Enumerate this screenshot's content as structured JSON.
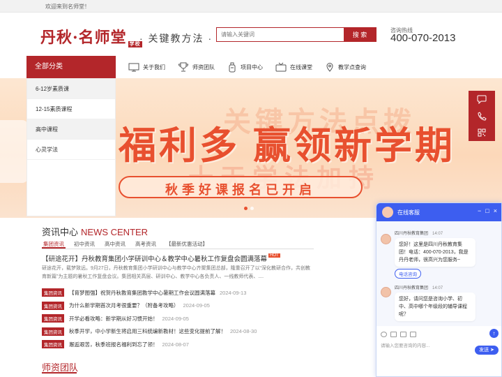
{
  "topbar": {
    "welcome": "欢迎来到名师堂！"
  },
  "header": {
    "logo_text": "丹秋·名师堂",
    "logo_tag": "学校",
    "slogan": "· 关键教方法 ·",
    "search_placeholder": "请输入关键词",
    "search_button": "搜 索",
    "hotline_label": "咨询热线",
    "hotline": "400-070-2013"
  },
  "category": {
    "title": "全部分类",
    "items": [
      "6-12岁素质课",
      "12-15素质课程",
      "高中课程",
      "心灵学法"
    ]
  },
  "nav": {
    "items": [
      {
        "label": "关于我们",
        "icon": "monitor-icon"
      },
      {
        "label": "师资团队",
        "icon": "trophy-icon"
      },
      {
        "label": "项目中心",
        "icon": "bottle-icon"
      },
      {
        "label": "在线课堂",
        "icon": "tv-icon"
      },
      {
        "label": "教学点查询",
        "icon": "pin-icon"
      }
    ]
  },
  "banner": {
    "ghost_line1": "关键方法点拨",
    "headline": "福利多 赢领新学期",
    "ghost_line2": "十天学法加持",
    "pill_text": "秋季好课报名已开启"
  },
  "news": {
    "title": "资讯中心",
    "title_en": "NEWS CENTER",
    "tabs": [
      "集团资讯",
      "初中资讯",
      "高中资讯",
      "高考资讯",
      "【最新优惠活动】"
    ],
    "feature_title": "【研途花开】丹秋教育集团小学研训中心＆教学中心暑秋工作复盘会圆满落幕",
    "feature_hot": "HOT",
    "feature_desc": "研途花开，载梦致远。9月27日，丹秋教育集团小学研训中心与教学中心齐聚集团总部，隆重召开了以“深化教研合作，共创教育新篇”为主题的暑秋工作复盘会议。集团相关高层、研训中心、教学中心各负责人、一线教师代表、....",
    "rows": [
      {
        "badge": "集团资讯",
        "title": "【育梦图强】祝贺丹秋教育集团教学中心暑期工作会议圆满落幕",
        "date": "2024-09-13"
      },
      {
        "badge": "集团资讯",
        "title": "为什么新学期首次月考很重要？（附备考攻略）",
        "date": "2024-09-05"
      },
      {
        "badge": "集团资讯",
        "title": "开学必看攻略：新学期从好习惯开始！",
        "date": "2024-09-05"
      },
      {
        "badge": "集团资讯",
        "title": "秋季开学，中小学新生将启用三科统编新教材！这些变化提前了解！",
        "date": "2024-08-30"
      },
      {
        "badge": "集团资讯",
        "title": "邂逅艰苦，秋季班报名福利到忘了领！",
        "date": "2024-08-07"
      }
    ]
  },
  "team": {
    "title": "师资团队"
  },
  "chat": {
    "title": "在线客服",
    "controls": [
      "−",
      "□",
      "×"
    ],
    "agent": "四川丹秋教育集团",
    "time1": "14:07",
    "msg1": "您好！这里是四川丹秋教育集团！电话：400-070-2013，我是丹丹老师，很高兴为您服务~",
    "chip": "电话咨询",
    "time2": "14:07",
    "msg2": "您好，请问您是咨询小学、初中、高中哪个年级段的辅导课程呢？",
    "fab": "↑",
    "input_placeholder": "请输入您要咨询的内容...",
    "send": "发送 ➤"
  },
  "colors": {
    "brand": "#b3262a",
    "chat": "#3d5ef0",
    "banner_accent": "#e8502f"
  }
}
